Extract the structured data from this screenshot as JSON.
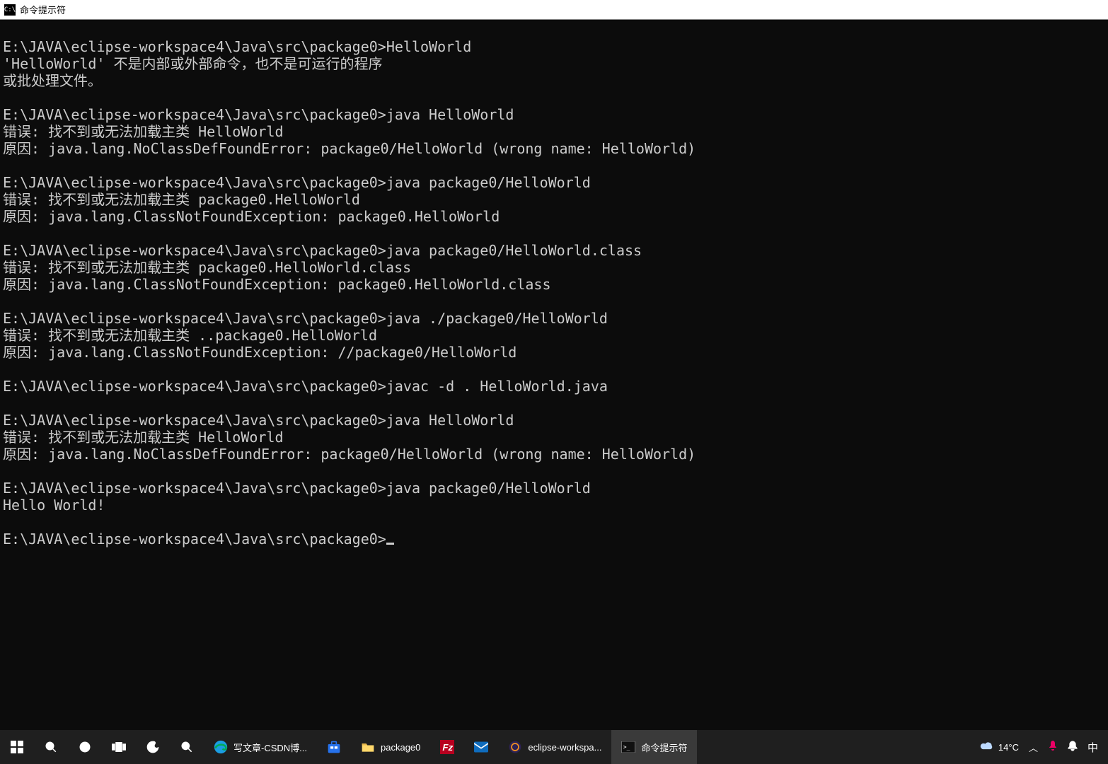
{
  "window": {
    "title": "命令提示符",
    "icon_label": "C:\\"
  },
  "terminal": {
    "lines": [
      "",
      "E:\\JAVA\\eclipse-workspace4\\Java\\src\\package0>HelloWorld",
      "'HelloWorld' 不是内部或外部命令，也不是可运行的程序",
      "或批处理文件。",
      "",
      "E:\\JAVA\\eclipse-workspace4\\Java\\src\\package0>java HelloWorld",
      "错误: 找不到或无法加载主类 HelloWorld",
      "原因: java.lang.NoClassDefFoundError: package0/HelloWorld (wrong name: HelloWorld)",
      "",
      "E:\\JAVA\\eclipse-workspace4\\Java\\src\\package0>java package0/HelloWorld",
      "错误: 找不到或无法加载主类 package0.HelloWorld",
      "原因: java.lang.ClassNotFoundException: package0.HelloWorld",
      "",
      "E:\\JAVA\\eclipse-workspace4\\Java\\src\\package0>java package0/HelloWorld.class",
      "错误: 找不到或无法加载主类 package0.HelloWorld.class",
      "原因: java.lang.ClassNotFoundException: package0.HelloWorld.class",
      "",
      "E:\\JAVA\\eclipse-workspace4\\Java\\src\\package0>java ./package0/HelloWorld",
      "错误: 找不到或无法加载主类 ..package0.HelloWorld",
      "原因: java.lang.ClassNotFoundException: //package0/HelloWorld",
      "",
      "E:\\JAVA\\eclipse-workspace4\\Java\\src\\package0>javac -d . HelloWorld.java",
      "",
      "E:\\JAVA\\eclipse-workspace4\\Java\\src\\package0>java HelloWorld",
      "错误: 找不到或无法加载主类 HelloWorld",
      "原因: java.lang.NoClassDefFoundError: package0/HelloWorld (wrong name: HelloWorld)",
      "",
      "E:\\JAVA\\eclipse-workspace4\\Java\\src\\package0>java package0/HelloWorld",
      "Hello World!",
      "",
      "E:\\JAVA\\eclipse-workspace4\\Java\\src\\package0>"
    ]
  },
  "taskbar": {
    "apps": [
      {
        "name": "start",
        "label": ""
      },
      {
        "name": "search",
        "label": ""
      },
      {
        "name": "cortana",
        "label": ""
      },
      {
        "name": "taskview",
        "label": ""
      },
      {
        "name": "copilot",
        "label": ""
      },
      {
        "name": "magnify",
        "label": ""
      },
      {
        "name": "edge",
        "label": "写文章-CSDN博..."
      },
      {
        "name": "store",
        "label": ""
      },
      {
        "name": "explorer",
        "label": "package0"
      },
      {
        "name": "filezilla",
        "label": ""
      },
      {
        "name": "mail",
        "label": ""
      },
      {
        "name": "eclipse",
        "label": "eclipse-workspa..."
      },
      {
        "name": "cmd",
        "label": "命令提示符",
        "active": true
      }
    ],
    "tray": {
      "weather": "14°C",
      "chevron": "︿"
    }
  }
}
